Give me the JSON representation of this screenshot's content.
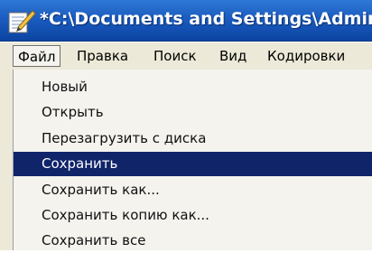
{
  "window": {
    "title": "*C:\\Documents and Settings\\Admin\\P"
  },
  "menubar": {
    "items": [
      {
        "label": "Файл",
        "active": true
      },
      {
        "label": "Правка"
      },
      {
        "label": "Поиск"
      },
      {
        "label": "Вид"
      },
      {
        "label": "Кодировки"
      }
    ]
  },
  "file_menu": {
    "items": [
      {
        "label": "Новый"
      },
      {
        "label": "Открыть"
      },
      {
        "label": "Перезагрузить с диска"
      },
      {
        "label": "Сохранить",
        "highlighted": true
      },
      {
        "label": "Сохранить как..."
      },
      {
        "label": "Сохранить копию как..."
      },
      {
        "label": "Сохранить все"
      }
    ]
  },
  "colors": {
    "titlebar": "#1a5cc0",
    "menubar": "#ece9d8",
    "menu_bg": "#f4f3ee",
    "highlight": "#10246a"
  },
  "icons": {
    "app": "notepad-pencil-icon"
  }
}
